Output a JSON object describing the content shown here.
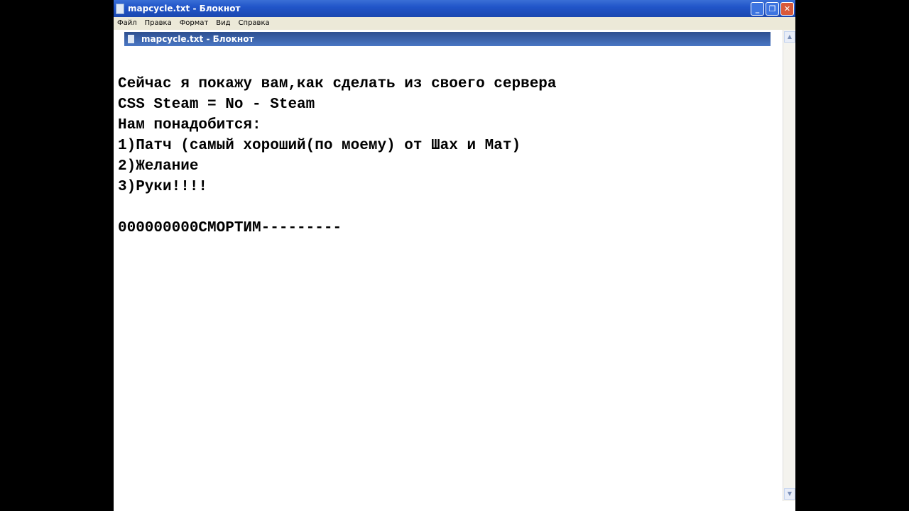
{
  "window": {
    "title": "mapcycle.txt - Блокнот",
    "min": "_",
    "max": "❐",
    "close": "✕"
  },
  "menu": [
    "Файл",
    "Правка",
    "Формат",
    "Вид",
    "Справка"
  ],
  "tooltip": {
    "title": "mapcycle.txt - Блокнот"
  },
  "lines": [
    "",
    "Сейчас я покажу вам,как сделать из своего сервера",
    "CSS Steam = No - Steam",
    "Нам понадобится:",
    "1)Патч (самый хороший(по моему) от Шах и Мат)",
    "2)Желание",
    "3)Руки!!!!",
    "",
    "000000000СМОРТИМ---------"
  ],
  "scroll": {
    "up": "▲",
    "down": "▼"
  }
}
